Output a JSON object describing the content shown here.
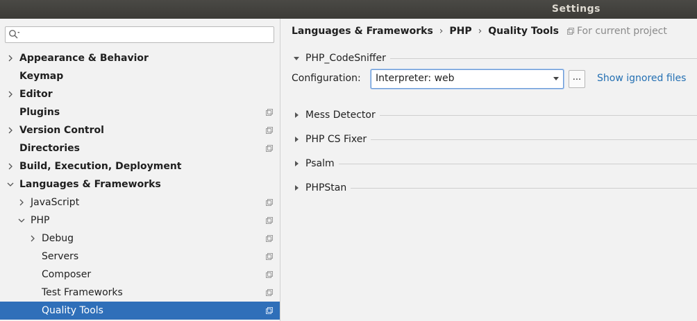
{
  "window": {
    "title": "Settings"
  },
  "search": {
    "placeholder": "",
    "value": ""
  },
  "tree": [
    {
      "label": "Appearance & Behavior",
      "level": 0,
      "arrow": "right",
      "bold": true,
      "project": false
    },
    {
      "label": "Keymap",
      "level": 0,
      "arrow": "none",
      "bold": true,
      "project": false
    },
    {
      "label": "Editor",
      "level": 0,
      "arrow": "right",
      "bold": true,
      "project": false
    },
    {
      "label": "Plugins",
      "level": 0,
      "arrow": "none",
      "bold": true,
      "project": true
    },
    {
      "label": "Version Control",
      "level": 0,
      "arrow": "right",
      "bold": true,
      "project": true
    },
    {
      "label": "Directories",
      "level": 0,
      "arrow": "none",
      "bold": true,
      "project": true
    },
    {
      "label": "Build, Execution, Deployment",
      "level": 0,
      "arrow": "right",
      "bold": true,
      "project": false
    },
    {
      "label": "Languages & Frameworks",
      "level": 0,
      "arrow": "down",
      "bold": true,
      "project": false
    },
    {
      "label": "JavaScript",
      "level": 1,
      "arrow": "right",
      "bold": false,
      "project": true
    },
    {
      "label": "PHP",
      "level": 1,
      "arrow": "down",
      "bold": false,
      "project": true
    },
    {
      "label": "Debug",
      "level": 2,
      "arrow": "right",
      "bold": false,
      "project": true
    },
    {
      "label": "Servers",
      "level": 2,
      "arrow": "none",
      "bold": false,
      "project": true
    },
    {
      "label": "Composer",
      "level": 2,
      "arrow": "none",
      "bold": false,
      "project": true
    },
    {
      "label": "Test Frameworks",
      "level": 2,
      "arrow": "none",
      "bold": false,
      "project": true
    },
    {
      "label": "Quality Tools",
      "level": 2,
      "arrow": "none",
      "bold": false,
      "project": true,
      "selected": true
    }
  ],
  "breadcrumb": {
    "part1": "Languages & Frameworks",
    "sep": "›",
    "part2": "PHP",
    "part3": "Quality Tools"
  },
  "for_current_project": "For current project",
  "codesniffer": {
    "title": "PHP_CodeSniffer",
    "config_label": "Configuration:",
    "config_value": "Interpreter: web",
    "browse_label": "...",
    "show_ignored": "Show ignored files"
  },
  "sections": [
    "Mess Detector",
    "PHP CS Fixer",
    "Psalm",
    "PHPStan"
  ],
  "colors": {
    "selection": "#2f6fb9",
    "link": "#2470b3",
    "titlebar": "#3c3b37"
  },
  "icons": {
    "search": "search-icon",
    "project": "project-scope-icon",
    "expand": "chevron-right-icon",
    "collapse": "chevron-down-icon"
  }
}
